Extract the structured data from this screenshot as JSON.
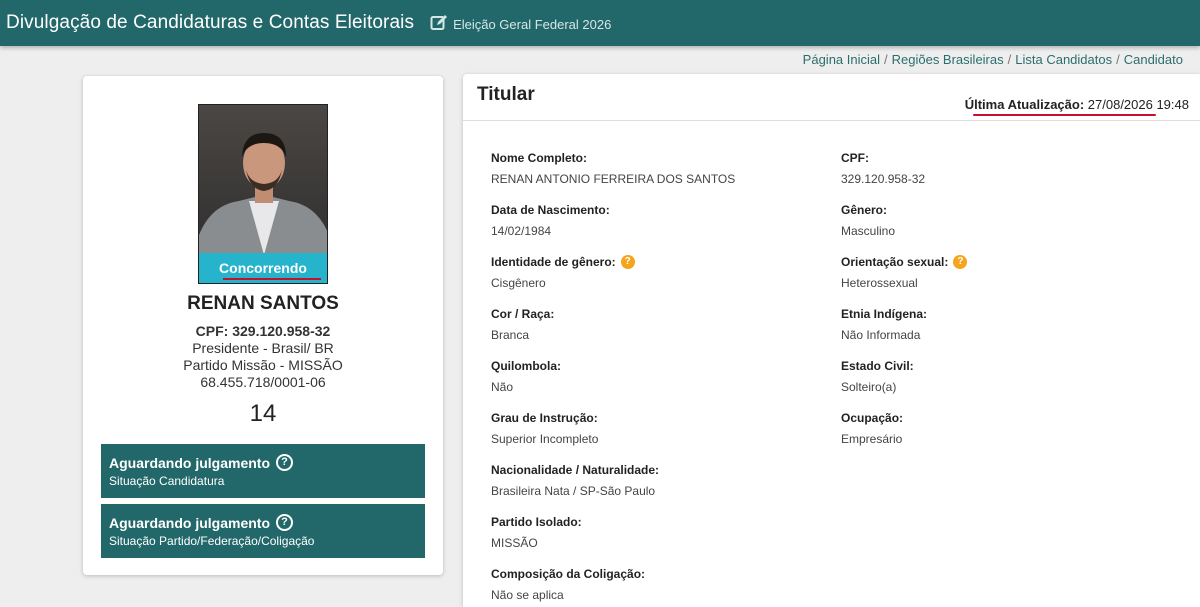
{
  "header": {
    "title": "Divulgação de Candidaturas e Contas Eleitorais",
    "election": "Eleição Geral Federal 2026",
    "edit_icon": "edit-square-icon",
    "bg_color": "#22686a"
  },
  "breadcrumb": [
    "Página Inicial",
    "Regiões Brasileiras",
    "Lista Candidatos",
    "Candidato"
  ],
  "candidate": {
    "status": "Concorrendo",
    "name": "RENAN SANTOS",
    "cpf_line": "CPF: 329.120.958-32",
    "role": "Presidente - Brasil/ BR",
    "party": "Partido Missão - MISSÃO",
    "cnpj": "68.455.718/0001-06",
    "number": "14",
    "situations": [
      {
        "title": "Aguardando julgamento",
        "subtitle": "Situação Candidatura"
      },
      {
        "title": "Aguardando julgamento",
        "subtitle": "Situação Partido/Federação/Coligação"
      }
    ]
  },
  "panel": {
    "title": "Titular",
    "updated_label": "Última Atualização:",
    "updated_value": "27/08/2026 19:48",
    "fields": [
      {
        "label": "Nome Completo:",
        "value": "RENAN ANTONIO FERREIRA DOS SANTOS"
      },
      {
        "label": "CPF:",
        "value": "329.120.958-32"
      },
      {
        "label": "Data de Nascimento:",
        "value": "14/02/1984"
      },
      {
        "label": "Gênero:",
        "value": "Masculino"
      },
      {
        "label": "Identidade de gênero:",
        "value": "Cisgênero"
      },
      {
        "label": "Orientação sexual:",
        "value": "Heterossexual"
      },
      {
        "label": "Cor / Raça:",
        "value": "Branca"
      },
      {
        "label": "Etnia Indígena:",
        "value": "Não Informada"
      },
      {
        "label": "Quilombola:",
        "value": "Não"
      },
      {
        "label": "Estado Civil:",
        "value": "Solteiro(a)"
      },
      {
        "label": "Grau de Instrução:",
        "value": "Superior Incompleto"
      },
      {
        "label": "Ocupação:",
        "value": "Empresário"
      },
      {
        "label": "Nacionalidade / Naturalidade:",
        "value": "Brasileira Nata / SP-São Paulo"
      },
      {
        "label": "Partido Isolado:",
        "value": "MISSÃO"
      },
      {
        "label": "Composição da Coligação:",
        "value": "Não se aplica"
      }
    ]
  },
  "colors": {
    "teal": "#22686a",
    "status_blue": "#26b3cc",
    "accent_red": "#c8102e",
    "info_orange": "#f4a51c"
  }
}
